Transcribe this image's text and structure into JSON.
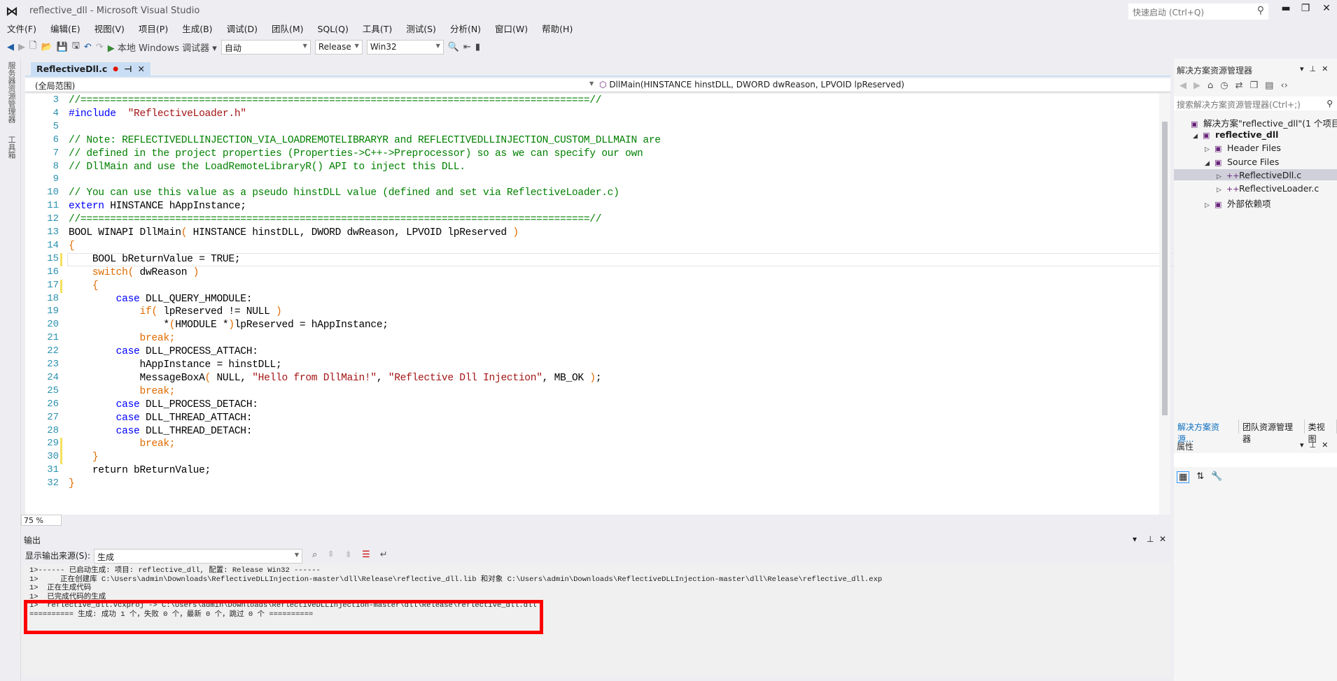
{
  "window": {
    "title": "reflective_dll - Microsoft Visual Studio",
    "quick_launch": "快速启动 (Ctrl+Q)"
  },
  "menu": [
    "文件(F)",
    "编辑(E)",
    "视图(V)",
    "项目(P)",
    "生成(B)",
    "调试(D)",
    "团队(M)",
    "SQL(Q)",
    "工具(T)",
    "测试(S)",
    "分析(N)",
    "窗口(W)",
    "帮助(H)"
  ],
  "toolbar": {
    "debug_target": "本地 Windows 调试器",
    "config_auto": "自动",
    "configuration": "Release",
    "platform": "Win32"
  },
  "left_strip": [
    "服务器资源管理器",
    "工具箱"
  ],
  "editor": {
    "tab": "ReflectiveDll.c",
    "scope": "(全局范围)",
    "member": "DllMain(HINSTANCE hinstDLL, DWORD dwReason, LPVOID lpReserved)",
    "zoom": "75 %",
    "changed_lines": [
      15,
      17,
      29,
      30
    ],
    "current_line": 15,
    "lines": [
      {
        "n": 3,
        "t": [
          [
            "cm",
            "//======================================================================================//"
          ]
        ]
      },
      {
        "n": 4,
        "t": [
          [
            "kw",
            "#include"
          ],
          [
            "",
            "  "
          ],
          [
            "str",
            "\"ReflectiveLoader.h\""
          ]
        ]
      },
      {
        "n": 5,
        "t": []
      },
      {
        "n": 6,
        "t": [
          [
            "cm",
            "// Note: REFLECTIVEDLLINJECTION_VIA_LOADREMOTELIBRARYR and REFLECTIVEDLLINJECTION_CUSTOM_DLLMAIN are"
          ]
        ]
      },
      {
        "n": 7,
        "t": [
          [
            "cm",
            "// defined in the project properties (Properties->C++->Preprocessor) so as we can specify our own"
          ]
        ]
      },
      {
        "n": 8,
        "t": [
          [
            "cm",
            "// DllMain and use the LoadRemoteLibraryR() API to inject this DLL."
          ]
        ]
      },
      {
        "n": 9,
        "t": []
      },
      {
        "n": 10,
        "t": [
          [
            "cm",
            "// You can use this value as a pseudo hinstDLL value (defined and set via ReflectiveLoader.c)"
          ]
        ]
      },
      {
        "n": 11,
        "t": [
          [
            "kw",
            "extern"
          ],
          [
            "",
            " HINSTANCE hAppInstance;"
          ]
        ]
      },
      {
        "n": 12,
        "t": [
          [
            "cm",
            "//======================================================================================//"
          ]
        ]
      },
      {
        "n": 13,
        "t": [
          [
            "",
            "BOOL WINAPI DllMain"
          ],
          [
            "op",
            "("
          ],
          [
            "",
            " HINSTANCE hinstDLL, DWORD dwReason, LPVOID lpReserved "
          ],
          [
            "op",
            ")"
          ]
        ]
      },
      {
        "n": 14,
        "t": [
          [
            "op",
            "{"
          ]
        ]
      },
      {
        "n": 15,
        "t": [
          [
            "",
            "    BOOL bReturnValue = TRUE;"
          ]
        ]
      },
      {
        "n": 16,
        "t": [
          [
            "",
            "    "
          ],
          [
            "op",
            "switch("
          ],
          [
            "",
            " dwReason "
          ],
          [
            "op",
            ")"
          ]
        ]
      },
      {
        "n": 17,
        "t": [
          [
            "",
            "    "
          ],
          [
            "op",
            "{"
          ]
        ]
      },
      {
        "n": 18,
        "t": [
          [
            "",
            "        "
          ],
          [
            "kw",
            "case"
          ],
          [
            "",
            " DLL_QUERY_HMODULE:"
          ]
        ]
      },
      {
        "n": 19,
        "t": [
          [
            "",
            "            "
          ],
          [
            "op",
            "if("
          ],
          [
            "",
            " lpReserved != NULL "
          ],
          [
            "op",
            ")"
          ]
        ]
      },
      {
        "n": 20,
        "t": [
          [
            "",
            "                *"
          ],
          [
            "op",
            "("
          ],
          [
            "",
            "HMODULE *"
          ],
          [
            "op",
            ")"
          ],
          [
            "",
            "lpReserved = hAppInstance;"
          ]
        ]
      },
      {
        "n": 21,
        "t": [
          [
            "",
            "            "
          ],
          [
            "op",
            "break;"
          ]
        ]
      },
      {
        "n": 22,
        "t": [
          [
            "",
            "        "
          ],
          [
            "kw",
            "case"
          ],
          [
            "",
            " DLL_PROCESS_ATTACH:"
          ]
        ]
      },
      {
        "n": 23,
        "t": [
          [
            "",
            "            hAppInstance = hinstDLL;"
          ]
        ]
      },
      {
        "n": 24,
        "t": [
          [
            "",
            "            MessageBoxA"
          ],
          [
            "op",
            "("
          ],
          [
            "",
            " NULL, "
          ],
          [
            "str",
            "\"Hello from DllMain!\""
          ],
          [
            "",
            ", "
          ],
          [
            "str",
            "\"Reflective Dll Injection\""
          ],
          [
            "",
            ", MB_OK "
          ],
          [
            "op",
            ")"
          ],
          [
            "",
            ";"
          ]
        ]
      },
      {
        "n": 25,
        "t": [
          [
            "",
            "            "
          ],
          [
            "op",
            "break;"
          ]
        ]
      },
      {
        "n": 26,
        "t": [
          [
            "",
            "        "
          ],
          [
            "kw",
            "case"
          ],
          [
            "",
            " DLL_PROCESS_DETACH:"
          ]
        ]
      },
      {
        "n": 27,
        "t": [
          [
            "",
            "        "
          ],
          [
            "kw",
            "case"
          ],
          [
            "",
            " DLL_THREAD_ATTACH:"
          ]
        ]
      },
      {
        "n": 28,
        "t": [
          [
            "",
            "        "
          ],
          [
            "kw",
            "case"
          ],
          [
            "",
            " DLL_THREAD_DETACH:"
          ]
        ]
      },
      {
        "n": 29,
        "t": [
          [
            "",
            "            "
          ],
          [
            "op",
            "break;"
          ]
        ]
      },
      {
        "n": 30,
        "t": [
          [
            "",
            "    "
          ],
          [
            "op",
            "}"
          ]
        ]
      },
      {
        "n": 31,
        "t": [
          [
            "",
            "    return bReturnValue;"
          ]
        ]
      },
      {
        "n": 32,
        "t": [
          [
            "op",
            "}"
          ]
        ]
      }
    ]
  },
  "output": {
    "title": "输出",
    "source_label": "显示输出来源(S):",
    "source_value": "生成",
    "lines": [
      "1>------ 已启动生成: 项目: reflective_dll, 配置: Release Win32 ------",
      "1>     正在创建库 C:\\Users\\admin\\Downloads\\ReflectiveDLLInjection-master\\dll\\Release\\reflective_dll.lib 和对象 C:\\Users\\admin\\Downloads\\ReflectiveDLLInjection-master\\dll\\Release\\reflective_dll.exp",
      "1>  正在生成代码",
      "1>  已完成代码的生成",
      "1>  reflective_dll.vcxproj -> C:\\Users\\admin\\Downloads\\ReflectiveDLLInjection-master\\dll\\Release\\reflective_dll.dll",
      "========== 生成: 成功 1 个，失败 0 个，最新 0 个，跳过 0 个 =========="
    ],
    "highlight_color": "#ff0000"
  },
  "solution_explorer": {
    "title": "解决方案资源管理器",
    "search_placeholder": "搜索解决方案资源管理器(Ctrl+;)",
    "items": [
      {
        "label": "解决方案\"reflective_dll\"(1 个项目)",
        "level": 0,
        "arrow": ""
      },
      {
        "label": "reflective_dll",
        "level": 1,
        "arrow": "◢",
        "bold": true
      },
      {
        "label": "Header Files",
        "level": 2,
        "arrow": "▷"
      },
      {
        "label": "Source Files",
        "level": 2,
        "arrow": "◢"
      },
      {
        "label": "ReflectiveDll.c",
        "level": 3,
        "arrow": "▷",
        "selected": true
      },
      {
        "label": "ReflectiveLoader.c",
        "level": 3,
        "arrow": "▷"
      },
      {
        "label": "外部依赖项",
        "level": 2,
        "arrow": "▷"
      }
    ],
    "tabs": [
      "解决方案资源...",
      "团队资源管理器",
      "类视图"
    ]
  },
  "properties": {
    "title": "属性"
  }
}
